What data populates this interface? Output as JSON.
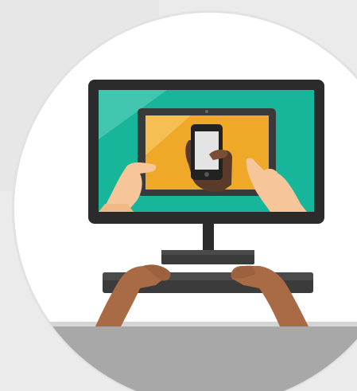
{
  "illustration": {
    "subject": "desktop-monitor-tablet-phone-hands-keyboard",
    "colors": {
      "outer_background": "#ebebeb",
      "circle_fill": "#ffffff",
      "circle_ring": "#e2e2e2",
      "monitor_bezel": "#2b2b2b",
      "monitor_screen": "#17b59a",
      "tablet_bezel": "#3a3a3a",
      "tablet_screen": "#f0a828",
      "phone_screen": "#e4e4e4",
      "keyboard": "#3b3b3b",
      "floor": "#a8a8a8",
      "skin_light": "#f6c59a",
      "skin_dark": "#a86b45",
      "skin_deep": "#5a3a28"
    }
  }
}
